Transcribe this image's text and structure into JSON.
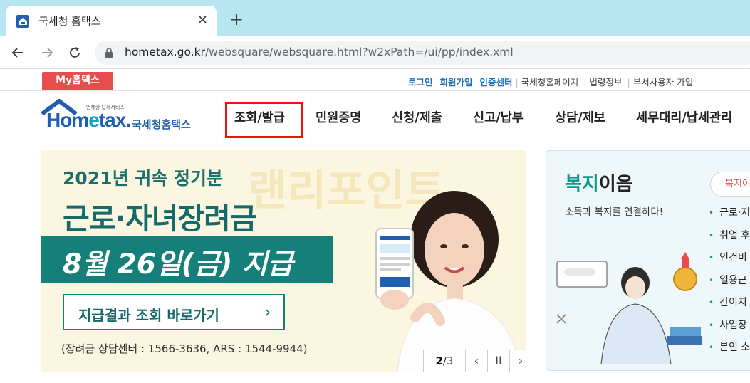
{
  "browser": {
    "tab_title": "국세청 홈택스",
    "close_glyph": "✕",
    "newtab_glyph": "+",
    "url_domain": "hometax.go.kr",
    "url_path": "/websquare/websquare.html?w2xPath=/ui/pp/index.xml"
  },
  "util": {
    "my_hometax": "My홈택스",
    "login": "로그인",
    "join": "회원가입",
    "cert": "인증센터",
    "nts_page": "국세청홈페이지",
    "law": "법령정보",
    "dept_user": "부서사용자 가입"
  },
  "logo": {
    "sub": "언제랑 납세서비스",
    "main_a": "Hom",
    "main_e": "e",
    "main_b": "tax.",
    "name": "국세청홈택스"
  },
  "gnb": [
    "조회/발급",
    "민원증명",
    "신청/제출",
    "신고/납부",
    "상담/제보",
    "세무대리/납세관리"
  ],
  "banner": {
    "subtitle": "2021년 귀속 정기분",
    "title": "근로·자녀장려금",
    "strip": "8월 26일(금) 지급",
    "button": "지급결과 조회 바로가기",
    "button_arrow": "›",
    "contact": "(장려금 상담센터 : 1566-3636, ARS : 1544-9944)",
    "watermark": "랜리포인트",
    "pager_current": "2",
    "pager_total": "/3",
    "prev": "‹",
    "pause": "II",
    "next": "›"
  },
  "panel": {
    "title_a": "복지",
    "title_b": "이음",
    "desc": "소득과 복지를 연결하다!",
    "pill": "복지이",
    "list": [
      "근로·지",
      "취업 후",
      "인건비",
      "일용근",
      "간이지",
      "사업장",
      "본인 소"
    ]
  },
  "colors": {
    "chrome_tab_bar": "#b7e5f2",
    "my_hometax": "#e84d4d",
    "teal": "#15807a",
    "highlight": "#ee1111",
    "link_blue": "#1c70b5"
  }
}
